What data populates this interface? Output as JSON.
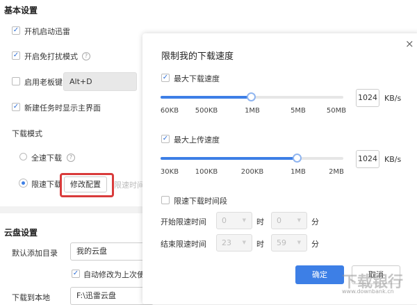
{
  "basic": {
    "title": "基本设置",
    "items": [
      {
        "label": "开机启动迅雷",
        "checked": true
      },
      {
        "label": "开启免打扰模式",
        "checked": true
      },
      {
        "label": "启用老板键",
        "checked": false,
        "hotkey": "Alt+D"
      },
      {
        "label": "新建任务时显示主界面",
        "checked": true
      }
    ],
    "download_mode": "下载模式",
    "full_speed": "全速下载",
    "limited": "限速下载",
    "modify_button": "修改配置",
    "limit_time_hint": "限速时间",
    "highlight_color": "#d93b3b"
  },
  "cloud": {
    "title": "云盘设置",
    "default_dir_label": "默认添加目录",
    "default_dir": "我的云盘",
    "auto_modify": "自动修改为上次使",
    "local_label": "下载到本地",
    "local_path": "F:\\迅雷云盘"
  },
  "dialog": {
    "title": "限制我的下载速度",
    "close": "×",
    "download": {
      "label": "最大下载速度",
      "checked": true,
      "ticks": [
        "60KB",
        "500KB",
        "1MB",
        "5MB",
        "50MB"
      ],
      "value": "1024",
      "unit": "KB/s",
      "position": "1MB"
    },
    "upload": {
      "label": "最大上传速度",
      "checked": true,
      "ticks": [
        "30KB",
        "100KB",
        "200KB",
        "1MB",
        "2MB"
      ],
      "value": "1024",
      "unit": "KB/s",
      "position": "1MB"
    },
    "period": {
      "label": "限速下载时间段",
      "checked": false,
      "start_label": "开始限速时间",
      "end_label": "结束限速时间",
      "start_h": "0",
      "start_m": "0",
      "end_h": "23",
      "end_m": "59",
      "hour": "时",
      "minute": "分"
    },
    "ok": "确定",
    "cancel": "取消",
    "accent": "#3d7fe6"
  },
  "watermark": {
    "text": "下载银行",
    "url": "www.downbank.cn"
  }
}
